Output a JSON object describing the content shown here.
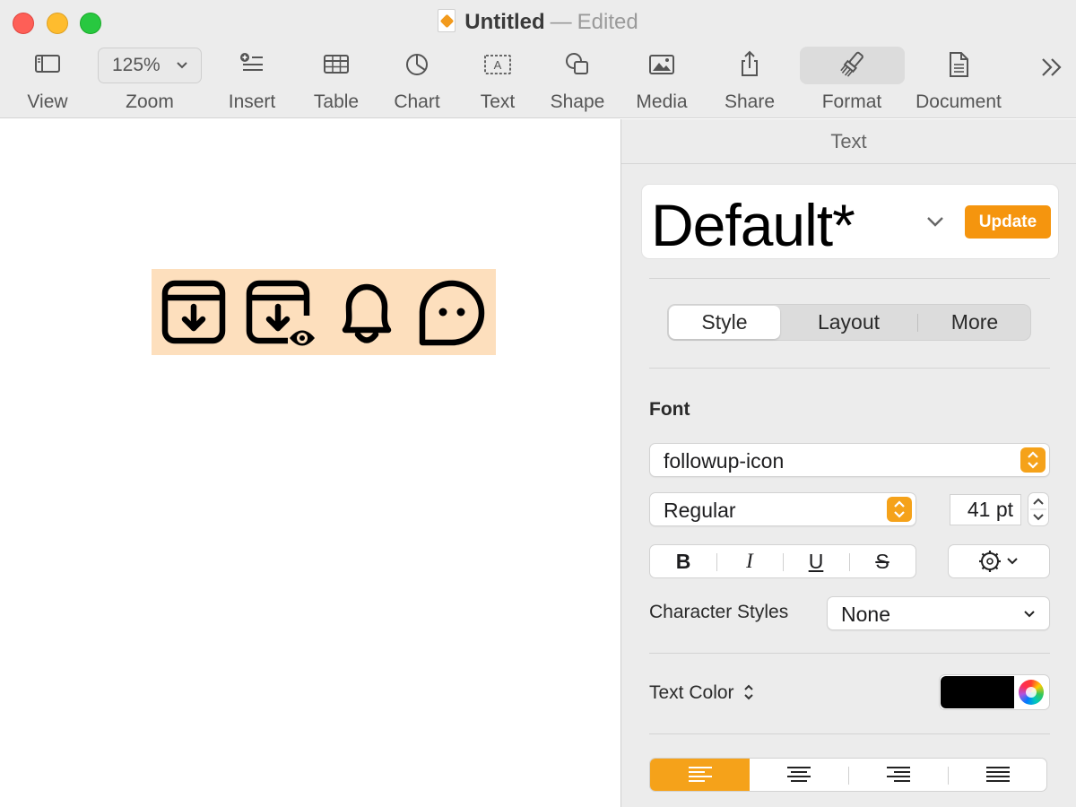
{
  "window": {
    "title": "Untitled",
    "separator": "—",
    "status": "Edited"
  },
  "toolbar": {
    "view": "View",
    "zoom_value": "125%",
    "zoom": "Zoom",
    "insert": "Insert",
    "table": "Table",
    "chart": "Chart",
    "text": "Text",
    "shape": "Shape",
    "media": "Media",
    "share": "Share",
    "format": "Format",
    "document": "Document"
  },
  "canvas": {
    "icons": [
      "archive-download-icon",
      "archive-download-preview-icon",
      "bell-icon",
      "chat-bubble-icon"
    ],
    "highlight_color": "#fddfbd"
  },
  "inspector": {
    "header": "Text",
    "paragraph_style": "Default*",
    "update_label": "Update",
    "tabs": [
      "Style",
      "Layout",
      "More"
    ],
    "active_tab": "Style",
    "font_heading": "Font",
    "font_family": "followup-icon",
    "font_weight": "Regular",
    "font_size": "41 pt",
    "bius": {
      "bold": "B",
      "italic": "I",
      "underline": "U",
      "strike": "S"
    },
    "char_styles_label": "Character Styles",
    "char_styles_value": "None",
    "text_color_label": "Text Color",
    "text_color": "#000000",
    "alignment_active": "left",
    "accent": "#f5950e"
  }
}
